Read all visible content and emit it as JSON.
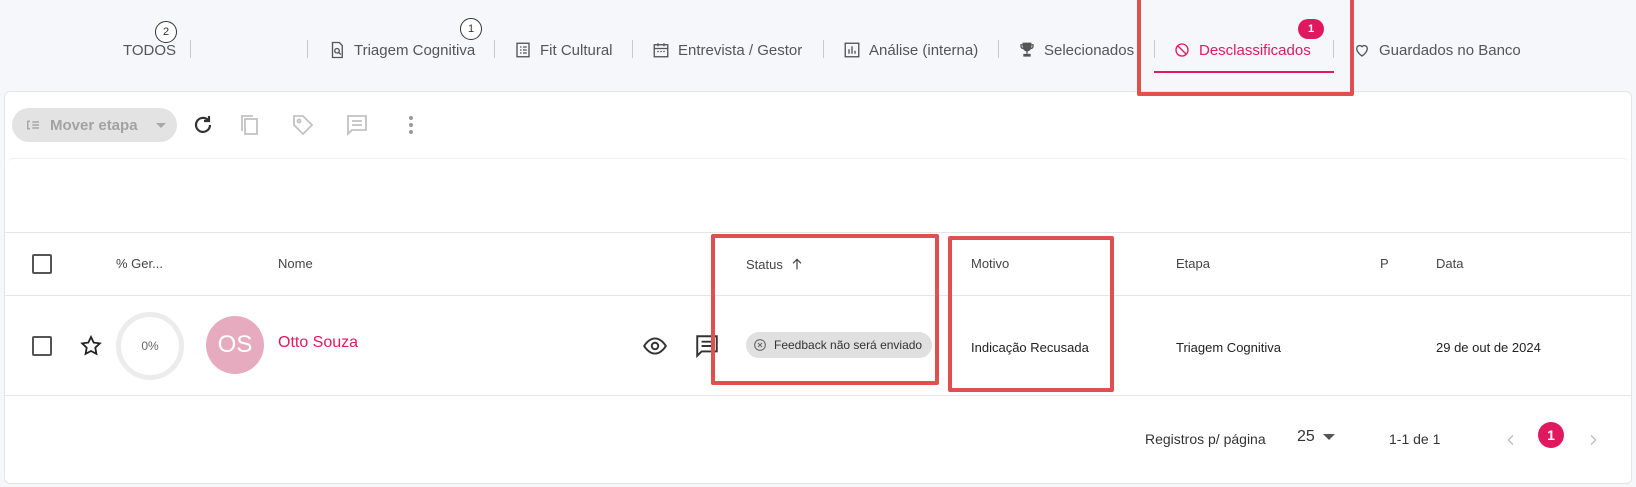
{
  "tabs": {
    "todos": {
      "label": "TODOS",
      "count": "2"
    },
    "triagem": {
      "label": "Triagem Cognitiva",
      "count": "1"
    },
    "fit": {
      "label": "Fit Cultural"
    },
    "entrevista": {
      "label": "Entrevista / Gestor"
    },
    "analise": {
      "label": "Análise (interna)"
    },
    "selecionados": {
      "label": "Selecionados"
    },
    "desclassificados": {
      "label": "Desclassificados",
      "count": "1"
    },
    "guardados": {
      "label": "Guardados no Banco"
    }
  },
  "toolbar": {
    "move_label": "Mover etapa"
  },
  "table": {
    "headers": {
      "ger": "% Ger...",
      "nome": "Nome",
      "status": "Status",
      "motivo": "Motivo",
      "etapa": "Etapa",
      "p": "P",
      "data": "Data"
    },
    "rows": [
      {
        "percent": "0%",
        "initials": "OS",
        "name": "Otto Souza",
        "status": "Feedback não será enviado",
        "motivo": "Indicação Recusada",
        "etapa": "Triagem Cognitiva",
        "data": "29 de out de 2024"
      }
    ]
  },
  "footer": {
    "per_page_label": "Registros p/ página",
    "per_page_value": "25",
    "range": "1-1 de 1",
    "current_page": "1"
  },
  "colors": {
    "accent": "#e0195e",
    "highlight": "#e05050",
    "avatar": "#e6abbf"
  }
}
